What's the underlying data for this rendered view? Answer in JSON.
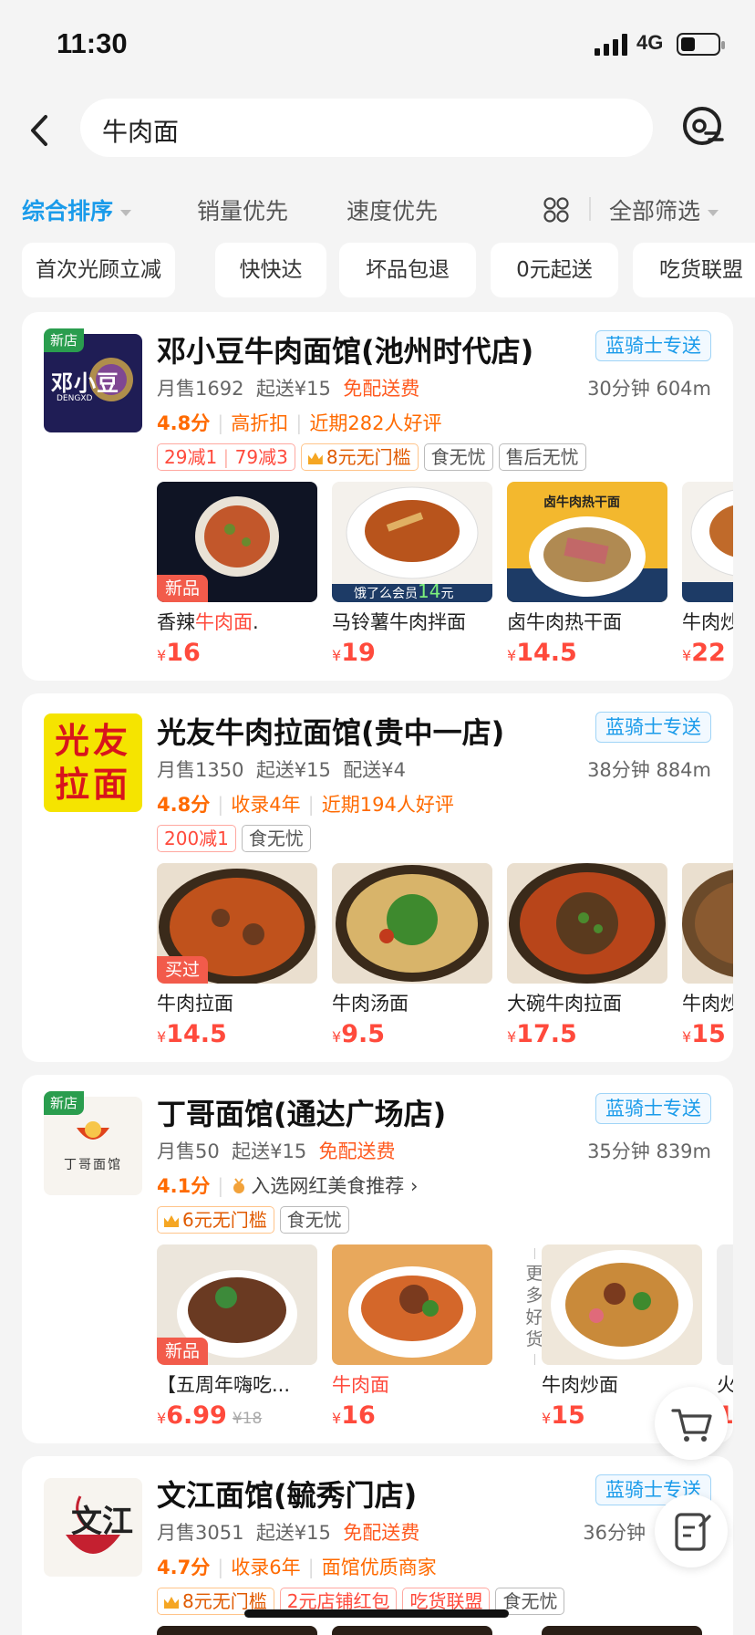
{
  "status": {
    "time": "11:30",
    "network": "4G"
  },
  "search": {
    "query": "牛肉面"
  },
  "sort": {
    "tabs": [
      "综合排序",
      "销量优先",
      "速度优先"
    ],
    "filter": "全部筛选"
  },
  "chips": [
    "首次光顾立减",
    "快快达",
    "坏品包退",
    "0元起送",
    "吃货联盟"
  ],
  "stores": [
    {
      "new_label": "新店",
      "logo_text": "邓小豆",
      "logo_sub": "DENGXD",
      "name": "邓小豆牛肉面馆(池州时代店)",
      "rider": "蓝骑士专送",
      "sales": "月售1692",
      "min": "起送¥15",
      "fee": "免配送费",
      "eta": "30分钟 604m",
      "score": "4.8分",
      "r1": "高折扣",
      "r2": "近期282人好评",
      "tags": [
        "29减1",
        "79减3",
        "8元无门槛",
        "食无忧",
        "售后无忧"
      ],
      "dishes": [
        {
          "badge": "新品",
          "name_a": "香辣",
          "name_b": "牛肉面",
          "name_c": ".",
          "price": "16"
        },
        {
          "name": "马铃薯牛肉拌面",
          "price": "19",
          "ad_a": "饿了么会员",
          "ad_b": "14",
          "ad_c": "元"
        },
        {
          "name": "卤牛肉热干面",
          "price": "14.5",
          "banner": "卤牛肉热干面"
        },
        {
          "name": "牛肉炒",
          "price": "22"
        }
      ]
    },
    {
      "logo_text": "光友拉面",
      "name": "光友牛肉拉面馆(贵中一店)",
      "rider": "蓝骑士专送",
      "sales": "月售1350",
      "min": "起送¥15",
      "fee": "配送¥4",
      "eta": "38分钟 884m",
      "score": "4.8分",
      "r1": "收录4年",
      "r2": "近期194人好评",
      "tags": [
        "200减1",
        "食无忧"
      ],
      "dishes": [
        {
          "badge": "买过",
          "name": "牛肉拉面",
          "price": "14.5"
        },
        {
          "name": "牛肉汤面",
          "price": "9.5"
        },
        {
          "name": "大碗牛肉拉面",
          "price": "17.5"
        },
        {
          "name": "牛肉炒",
          "price": "15"
        }
      ]
    },
    {
      "new_label": "新店",
      "logo_text": "丁哥面馆",
      "name": "丁哥面馆(通达广场店)",
      "rider": "蓝骑士专送",
      "sales": "月售50",
      "min": "起送¥15",
      "fee": "免配送费",
      "eta": "35分钟 839m",
      "score": "4.1分",
      "r1": "入选网红美食推荐 ›",
      "tags": [
        "6元无门槛",
        "食无忧"
      ],
      "dishes": [
        {
          "badge": "新品",
          "name": "【五周年嗨吃...",
          "price": "6.99",
          "orig": "¥18"
        },
        {
          "name": "牛肉面",
          "price": "16"
        },
        {
          "name": "牛肉炒面",
          "price": "15"
        },
        {
          "name": "火",
          "price": "1"
        }
      ],
      "more": "更多好货"
    },
    {
      "logo_text": "文江",
      "name": "文江面馆(毓秀门店)",
      "rider": "蓝骑士专送",
      "sales": "月售3051",
      "min": "起送¥15",
      "fee": "免配送费",
      "eta": "36分钟",
      "score": "4.7分",
      "r1": "收录6年",
      "r2": "面馆优质商家",
      "tags": [
        "8元无门槛",
        "2元店铺红包",
        "吃货联盟",
        "食无忧"
      ]
    }
  ],
  "currency": "¥"
}
